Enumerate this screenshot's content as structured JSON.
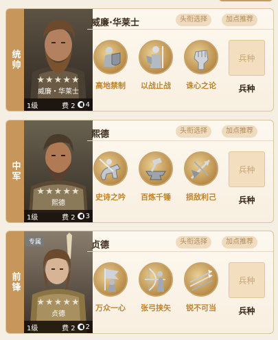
{
  "colors": {
    "accent": "#c7965a",
    "skill_text": "#c0832b",
    "chip_bg": "#efdcc0"
  },
  "cards": [
    {
      "role": "统帅",
      "name": "威廉·华莱士",
      "portrait_name": "威廉・华莱士",
      "stars": "★★★★★",
      "level": "1级",
      "cost": "费 2",
      "horses": "4",
      "chip_title": "头衔选择",
      "chip_points": "加点推荐",
      "skills": [
        {
          "name": "高地禁制",
          "icon": "soldier-shield-icon"
        },
        {
          "name": "以战止战",
          "icon": "armored-knight-icon"
        },
        {
          "name": "诛心之论",
          "icon": "raised-fist-icon"
        }
      ],
      "unit_placeholder": "兵种",
      "unit_label": "兵种"
    },
    {
      "role": "中军",
      "name": "熙德",
      "portrait_name": "熙德",
      "stars": "★★★★★",
      "level": "1级",
      "cost": "费 2",
      "horses": "3",
      "chip_title": "头衔选择",
      "chip_points": "加点推荐",
      "skills": [
        {
          "name": "史诗之吟",
          "icon": "horseman-icon"
        },
        {
          "name": "百炼千锤",
          "icon": "anvil-hammer-icon"
        },
        {
          "name": "损敌利己",
          "icon": "crossed-arrows-icon"
        }
      ],
      "unit_placeholder": "兵种",
      "unit_label": "兵种"
    },
    {
      "role": "前锋",
      "name": "贞德",
      "portrait_name": "贞德",
      "badge": "专属",
      "stars": "★★★★★",
      "level": "1级",
      "cost": "费 2",
      "horses": "2",
      "chip_title": "头衔选择",
      "chip_points": "加点推荐",
      "skills": [
        {
          "name": "万众一心",
          "icon": "banner-bearer-icon"
        },
        {
          "name": "张弓挟矢",
          "icon": "archer-icon"
        },
        {
          "name": "锐不可当",
          "icon": "spears-icon"
        }
      ],
      "unit_placeholder": "兵种",
      "unit_label": "兵种"
    }
  ]
}
